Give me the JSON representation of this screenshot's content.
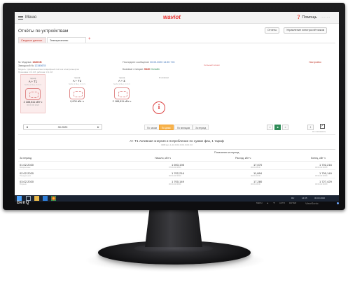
{
  "header": {
    "menu_label": "Меню",
    "logo": "waviot",
    "help_label": "Помощь",
    "user_label": "········"
  },
  "page_title": "Отчёты по устройствам",
  "toolbar": {
    "reports_button": "Отчеты",
    "manage_button": "Управление электросчётчиком"
  },
  "tabs": [
    {
      "label": "Сводные данные"
    },
    {
      "label": "Электричество"
    }
  ],
  "tab_add": "+",
  "device": {
    "modem_label": "№ Модема:",
    "modem_value": "1680CB",
    "meter_label": "Заводской №",
    "meter_value": "12345678",
    "model_line": "Модель: трёхфазный многотарифный счётчик электроэнергии",
    "firmware_line": "Прошивка: 3.3.3.8, рабочая: 3.3.3.8",
    "last_msg_label": "Последнее сообщение",
    "last_msg_value": "30.03.2020 14:35 +03",
    "signal_label": "Сильный сигнал",
    "stations_label": "Базовые станции:",
    "stations_value": "9849",
    "status": "Онлайн",
    "settings_link": "Настройки"
  },
  "cards": [
    {
      "label": "тариф",
      "name": "A + T1",
      "sub": "NAN (1 Мн), О.О.Ч",
      "value": "2 188,811 кВт·ч",
      "value_sub": "00:00:00 2020"
    },
    {
      "label": "тариф",
      "name": "A + T2",
      "sub": "NAN (1 Мн), О.О.Ч",
      "value": "0,000 кВт·ч",
      "value_sub": ""
    },
    {
      "label": "тариф",
      "name": "A + Σ",
      "sub": "NAN (1 Мн), О.О.Ч",
      "value": "2 188,811 кВт·ч",
      "value_sub": ""
    },
    {
      "label": "В Android",
      "name": "",
      "sub": "",
      "value": "",
      "value_sub": ""
    }
  ],
  "info_glyph": "i",
  "date_range": "30.2020",
  "period_tabs": [
    "По часам",
    "По дням",
    "По месяцам",
    "За период"
  ],
  "period_active": 1,
  "view_buttons": [
    "≡",
    "■",
    "≡"
  ],
  "view_active": 1,
  "export_label": "⇩",
  "checkbox": {
    "mark": "✓",
    "label": "Не показывать"
  },
  "table": {
    "title": "A+ T1 Активная энергия и потребление по сумме фаз, 1 тариф",
    "subtitle": "1680 вкл. 1.4.0.0.0.0.0.0.0.0.0.0.0.0",
    "col_period": "За период",
    "group_header": "Показания за период",
    "columns": [
      "Начало, кВт·ч",
      "Расход, кВт·ч",
      "Конец, кВт·ч"
    ],
    "rows": [
      {
        "date": "01.02.2020",
        "day": "Воскресенье",
        "start": "1 693,198",
        "start_sub": "07:00-00:00/00",
        "usage": "17,070",
        "usage_sub": "00:00-00:00",
        "end": "1 702,216",
        "end_sub": "00:00-00:00/00"
      },
      {
        "date": "02.02.2020",
        "day": "Понедельник",
        "start": "1 702,216",
        "start_sub": "00:00-00:00/00",
        "usage": "11,884",
        "usage_sub": "00:00-00:00",
        "end": "1 700,149",
        "end_sub": "00:00-00:00/00"
      },
      {
        "date": "03.02.2020",
        "day": "Вторник",
        "start": "1 700,149",
        "start_sub": "00:00-00:00/00",
        "usage": "17,280",
        "usage_sub": "00:00-00:00",
        "end": "1 727,429",
        "end_sub": "00:00-00:00/00"
      }
    ]
  },
  "taskbar": {
    "tray_text": "RU",
    "time": "14:35",
    "date": "30.03.2020"
  },
  "monitor": {
    "brand": "BenQ",
    "model": "ViewSonic",
    "buttons": [
      "MENU",
      "▲",
      "▼",
      "AUTO",
      "ENTER"
    ]
  }
}
